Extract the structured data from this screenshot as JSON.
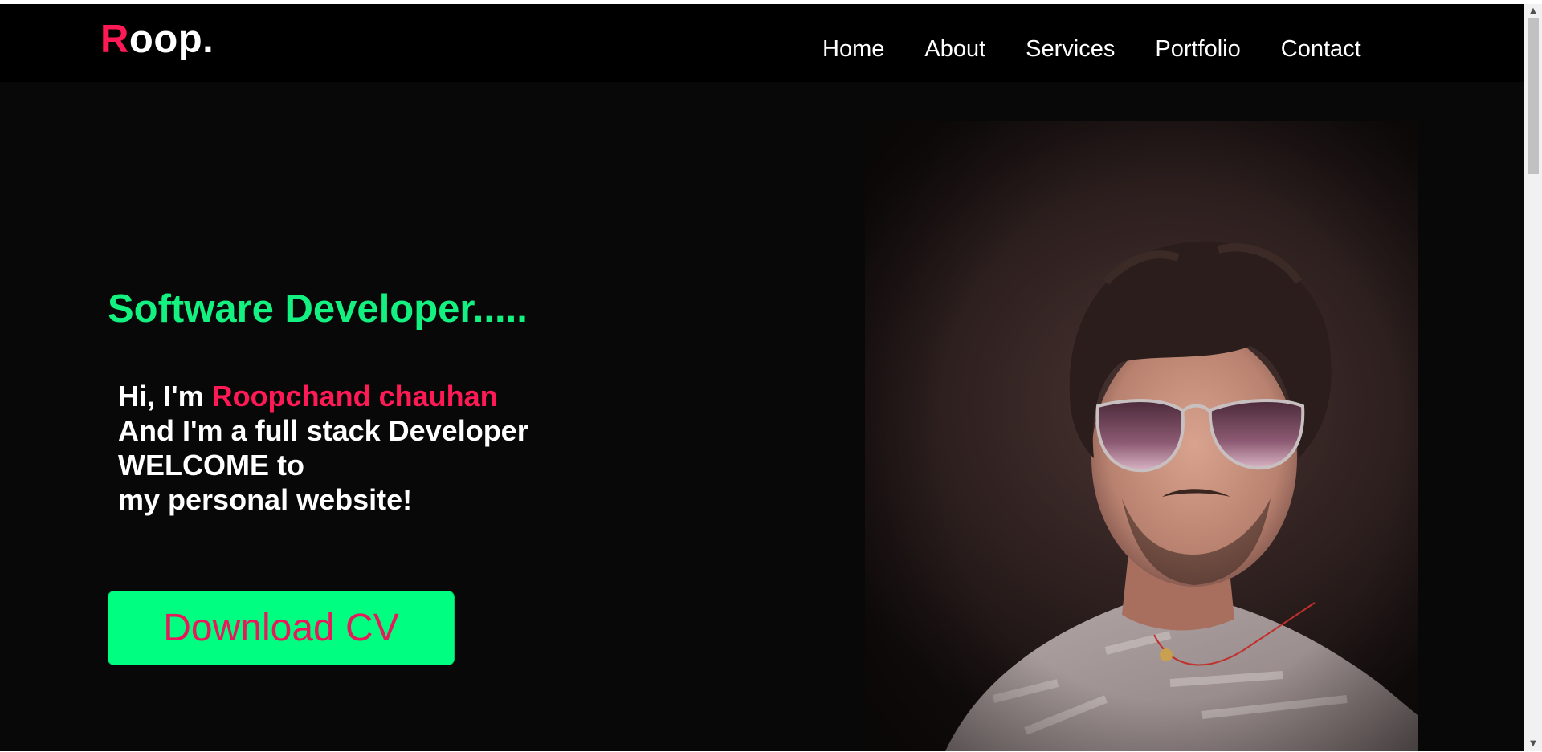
{
  "logo": {
    "first_letter": "R",
    "rest": "oop."
  },
  "nav": {
    "items": [
      {
        "label": "Home"
      },
      {
        "label": "About"
      },
      {
        "label": "Services"
      },
      {
        "label": "Portfolio"
      },
      {
        "label": "Contact"
      }
    ]
  },
  "hero": {
    "role": "Software Developer.....",
    "greeting_prefix": "Hi, I'm ",
    "name": "Roopchand chauhan",
    "line2": "And I'm a full stack Developer",
    "line3": "WELCOME to",
    "line4": "my personal website!",
    "cta_label": "Download CV"
  },
  "scrollbar": {
    "up_arrow": "▲",
    "down_arrow": "▼"
  },
  "colors": {
    "accent_pink": "#ff1a56",
    "accent_green": "#13f281",
    "button_green": "#00ff80",
    "background": "#080808",
    "navbar": "#000000"
  }
}
